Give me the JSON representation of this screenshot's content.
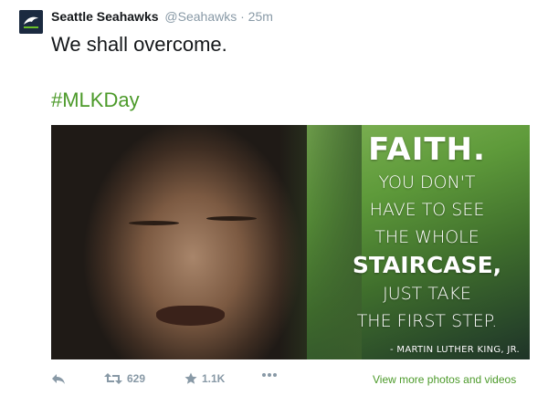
{
  "tweet": {
    "author": {
      "name": "Seattle Seahawks",
      "handle": "@Seahawks",
      "separator": "·",
      "time": "25m",
      "avatar_icon": "seahawks-logo"
    },
    "text": "We shall overcome.",
    "hashtag": "#MLKDay",
    "media": {
      "quote": {
        "line1": "FAITH.",
        "line2": "YOU DON'T",
        "line3": "HAVE TO SEE",
        "line4": "THE WHOLE",
        "line5": "STAIRCASE,",
        "line6": "JUST TAKE",
        "line7": "THE FIRST STEP.",
        "attribution": "- MARTIN LUTHER KING, JR."
      }
    },
    "actions": {
      "reply_icon": "reply-icon",
      "retweet_icon": "retweet-icon",
      "retweet_count": "629",
      "favorite_icon": "star-icon",
      "favorite_count": "1.1K",
      "more_icon": "more-icon",
      "view_more": "View more photos and videos"
    }
  },
  "colors": {
    "link_green": "#4c9a2a",
    "meta_gray": "#8899a6",
    "avatar_navy": "#1b2a40"
  }
}
